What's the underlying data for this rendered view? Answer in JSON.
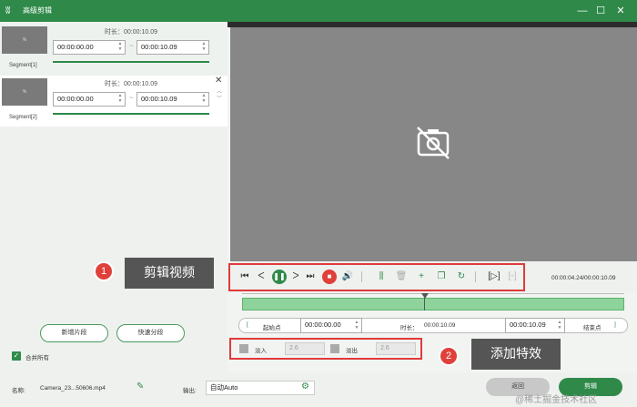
{
  "window": {
    "title": "高级剪辑",
    "minimize": "—",
    "maximize": "☐",
    "close": "✕"
  },
  "segments": [
    {
      "label": "Segment[1]",
      "duration_label": "时长：",
      "duration": "00:00:10.09",
      "start": "00:00:00.00",
      "end": "00:00:10.09",
      "thumb": "%"
    },
    {
      "label": "Segment[2]",
      "duration_label": "时长：",
      "duration": "00:00:10.09",
      "start": "00:00:00.00",
      "end": "00:00:10.09",
      "thumb": "%"
    }
  ],
  "left_buttons": {
    "new_segment": "新增片段",
    "quick_split": "快速分段",
    "merge_all": "合并所有"
  },
  "player": {
    "time_display": "00:00:04.24/00:00:10.09"
  },
  "trim": {
    "start_label": "起始点",
    "start_value": "00:00:00.00",
    "duration_label": "时长：",
    "duration_value": "00:00:10.09",
    "end_value": "00:00:10.09",
    "end_label": "结束点",
    "bracket_left": "[",
    "bracket_right": "]"
  },
  "effects": {
    "fade_in_label": "淡入",
    "fade_in_value": "2.6",
    "fade_out_label": "淡出",
    "fade_out_value": "2.6"
  },
  "callouts": [
    {
      "number": "1",
      "text": "剪辑视频"
    },
    {
      "number": "2",
      "text": "添加特效"
    }
  ],
  "bottom": {
    "name_label": "名称:",
    "filename": "Camera_23...50606.mp4",
    "output_label": "输出:",
    "output_value": "自动Auto",
    "back_button": "返回",
    "cut_button": "剪辑"
  },
  "watermark": "@稀土掘金技术社区",
  "colors": {
    "accent": "#2f8a4a",
    "callout_red": "#e03a3a",
    "video_bg": "#878787"
  }
}
